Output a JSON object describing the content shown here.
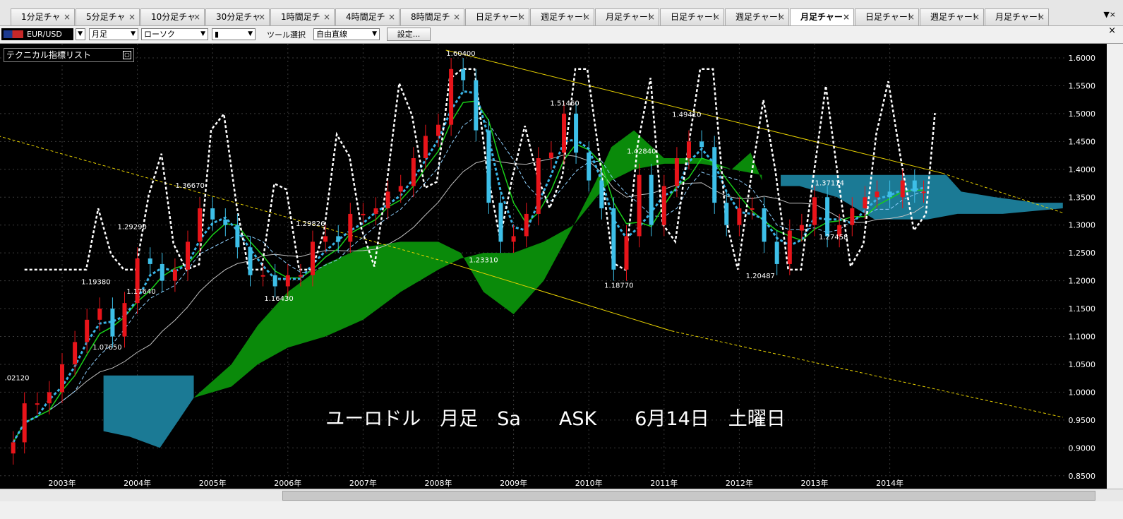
{
  "tabs": [
    {
      "label": "1分足チャ",
      "close": "×",
      "active": false
    },
    {
      "label": "5分足チャ",
      "close": "×",
      "active": false
    },
    {
      "label": "10分足チャ",
      "close": "×",
      "active": false
    },
    {
      "label": "30分足チャ",
      "close": "×",
      "active": false
    },
    {
      "label": "1時間足チ",
      "close": "×",
      "active": false
    },
    {
      "label": "4時間足チ",
      "close": "×",
      "active": false
    },
    {
      "label": "8時間足チ",
      "close": "×",
      "active": false
    },
    {
      "label": "日足チャー!",
      "close": "×",
      "active": false
    },
    {
      "label": "週足チャー!",
      "close": "×",
      "active": false
    },
    {
      "label": "月足チャー!",
      "close": "×",
      "active": false
    },
    {
      "label": "日足チャー!",
      "close": "×",
      "active": false
    },
    {
      "label": "週足チャー!",
      "close": "×",
      "active": false
    },
    {
      "label": "月足チャー",
      "close": "×",
      "active": true
    },
    {
      "label": "日足チャー!",
      "close": "×",
      "active": false
    },
    {
      "label": "週足チャー!",
      "close": "×",
      "active": false
    },
    {
      "label": "月足チャー!",
      "close": "×",
      "active": false
    }
  ],
  "tabbar_menu": "▼×",
  "toolbar": {
    "symbol": "EUR/USD",
    "period": "月足",
    "chart_type": "ローソク",
    "line_style": "▮",
    "tool_label": "ツール選択",
    "tool": "自由直線",
    "settings": "設定..."
  },
  "panel": {
    "title": "テクニカル指標リスト",
    "toggle": "▢"
  },
  "colors": {
    "bg": "#000000",
    "up": "#e8141a",
    "down": "#3dbfe8",
    "kumo_green": "#0a8a0a",
    "kumo_teal": "#1b7a95",
    "trend": "#e6d000"
  },
  "chart_data": {
    "type": "candlestick",
    "symbol": "EUR/USD",
    "timeframe": "monthly",
    "overlay_title": "ユーロドル　月足　Sa　　ASK　　6月14日　土曜日",
    "xlabels": [
      "2003年",
      "2004年",
      "2005年",
      "2006年",
      "2007年",
      "2008年",
      "2009年",
      "2010年",
      "2011年",
      "2012年",
      "2013年",
      "2014年"
    ],
    "ylim": [
      0.85,
      1.62
    ],
    "yticks": [
      "1.6000",
      "1.5500",
      "1.5000",
      "1.4500",
      "1.4000",
      "1.3500",
      "1.3000",
      "1.2500",
      "1.2000",
      "1.1500",
      "1.1000",
      "1.0500",
      "1.0000",
      "0.9500",
      "0.9000",
      "0.8500"
    ],
    "annotations": [
      {
        "label": "1.60400",
        "t": 2008.3,
        "v": 1.604
      },
      {
        "label": "1.51460",
        "t": 2009.68,
        "v": 1.5146
      },
      {
        "label": "1.49410",
        "t": 2011.3,
        "v": 1.4941
      },
      {
        "label": "1.42840",
        "t": 2010.7,
        "v": 1.4284
      },
      {
        "label": "1.37114",
        "t": 2013.2,
        "v": 1.37114
      },
      {
        "label": "1.36670",
        "t": 2004.7,
        "v": 1.3667
      },
      {
        "label": "1.29290",
        "t": 2003.93,
        "v": 1.2929
      },
      {
        "label": "1.29826",
        "t": 2006.3,
        "v": 1.29826
      },
      {
        "label": "1.23310",
        "t": 2008.6,
        "v": 1.2331
      },
      {
        "label": "1.19380",
        "t": 2003.45,
        "v": 1.1938
      },
      {
        "label": "1.17640",
        "t": 2004.05,
        "v": 1.1764
      },
      {
        "label": "1.16430",
        "t": 2005.88,
        "v": 1.1643
      },
      {
        "label": "1.18770",
        "t": 2010.4,
        "v": 1.1877
      },
      {
        "label": "1.20487",
        "t": 2012.28,
        "v": 1.20487
      },
      {
        "label": "1.27458",
        "t": 2013.25,
        "v": 1.27458
      },
      {
        "label": "1.07650",
        "t": 2003.6,
        "v": 1.0765
      },
      {
        "label": ".02120",
        "t": 2002.4,
        "v": 1.0212
      }
    ],
    "candles_close": [
      {
        "t": 2002.35,
        "v": 0.91
      },
      {
        "t": 2002.5,
        "v": 0.98
      },
      {
        "t": 2002.67,
        "v": 0.98
      },
      {
        "t": 2002.83,
        "v": 1.0
      },
      {
        "t": 2003.0,
        "v": 1.05
      },
      {
        "t": 2003.17,
        "v": 1.09
      },
      {
        "t": 2003.33,
        "v": 1.13
      },
      {
        "t": 2003.5,
        "v": 1.15
      },
      {
        "t": 2003.67,
        "v": 1.1
      },
      {
        "t": 2003.83,
        "v": 1.16
      },
      {
        "t": 2004.0,
        "v": 1.24
      },
      {
        "t": 2004.17,
        "v": 1.23
      },
      {
        "t": 2004.33,
        "v": 1.2
      },
      {
        "t": 2004.5,
        "v": 1.22
      },
      {
        "t": 2004.67,
        "v": 1.27
      },
      {
        "t": 2004.83,
        "v": 1.33
      },
      {
        "t": 2005.0,
        "v": 1.31
      },
      {
        "t": 2005.17,
        "v": 1.3
      },
      {
        "t": 2005.33,
        "v": 1.26
      },
      {
        "t": 2005.5,
        "v": 1.21
      },
      {
        "t": 2005.67,
        "v": 1.21
      },
      {
        "t": 2005.83,
        "v": 1.19
      },
      {
        "t": 2006.0,
        "v": 1.21
      },
      {
        "t": 2006.17,
        "v": 1.21
      },
      {
        "t": 2006.33,
        "v": 1.27
      },
      {
        "t": 2006.5,
        "v": 1.28
      },
      {
        "t": 2006.67,
        "v": 1.27
      },
      {
        "t": 2006.83,
        "v": 1.32
      },
      {
        "t": 2007.0,
        "v": 1.32
      },
      {
        "t": 2007.17,
        "v": 1.33
      },
      {
        "t": 2007.33,
        "v": 1.36
      },
      {
        "t": 2007.5,
        "v": 1.37
      },
      {
        "t": 2007.67,
        "v": 1.42
      },
      {
        "t": 2007.83,
        "v": 1.46
      },
      {
        "t": 2008.0,
        "v": 1.48
      },
      {
        "t": 2008.17,
        "v": 1.58
      },
      {
        "t": 2008.33,
        "v": 1.56
      },
      {
        "t": 2008.5,
        "v": 1.47
      },
      {
        "t": 2008.67,
        "v": 1.34
      },
      {
        "t": 2008.83,
        "v": 1.27
      },
      {
        "t": 2009.0,
        "v": 1.28
      },
      {
        "t": 2009.17,
        "v": 1.32
      },
      {
        "t": 2009.33,
        "v": 1.42
      },
      {
        "t": 2009.5,
        "v": 1.43
      },
      {
        "t": 2009.67,
        "v": 1.5
      },
      {
        "t": 2009.83,
        "v": 1.43
      },
      {
        "t": 2010.0,
        "v": 1.38
      },
      {
        "t": 2010.17,
        "v": 1.33
      },
      {
        "t": 2010.33,
        "v": 1.22
      },
      {
        "t": 2010.5,
        "v": 1.28
      },
      {
        "t": 2010.67,
        "v": 1.39
      },
      {
        "t": 2010.83,
        "v": 1.3
      },
      {
        "t": 2011.0,
        "v": 1.37
      },
      {
        "t": 2011.17,
        "v": 1.42
      },
      {
        "t": 2011.33,
        "v": 1.45
      },
      {
        "t": 2011.5,
        "v": 1.44
      },
      {
        "t": 2011.67,
        "v": 1.34
      },
      {
        "t": 2011.83,
        "v": 1.3
      },
      {
        "t": 2012.0,
        "v": 1.33
      },
      {
        "t": 2012.17,
        "v": 1.33
      },
      {
        "t": 2012.33,
        "v": 1.27
      },
      {
        "t": 2012.5,
        "v": 1.23
      },
      {
        "t": 2012.67,
        "v": 1.29
      },
      {
        "t": 2012.83,
        "v": 1.3
      },
      {
        "t": 2013.0,
        "v": 1.35
      },
      {
        "t": 2013.17,
        "v": 1.28
      },
      {
        "t": 2013.33,
        "v": 1.3
      },
      {
        "t": 2013.5,
        "v": 1.33
      },
      {
        "t": 2013.67,
        "v": 1.35
      },
      {
        "t": 2013.83,
        "v": 1.36
      },
      {
        "t": 2014.0,
        "v": 1.35
      },
      {
        "t": 2014.17,
        "v": 1.38
      },
      {
        "t": 2014.33,
        "v": 1.36
      },
      {
        "t": 2014.45,
        "v": 1.36
      }
    ]
  }
}
